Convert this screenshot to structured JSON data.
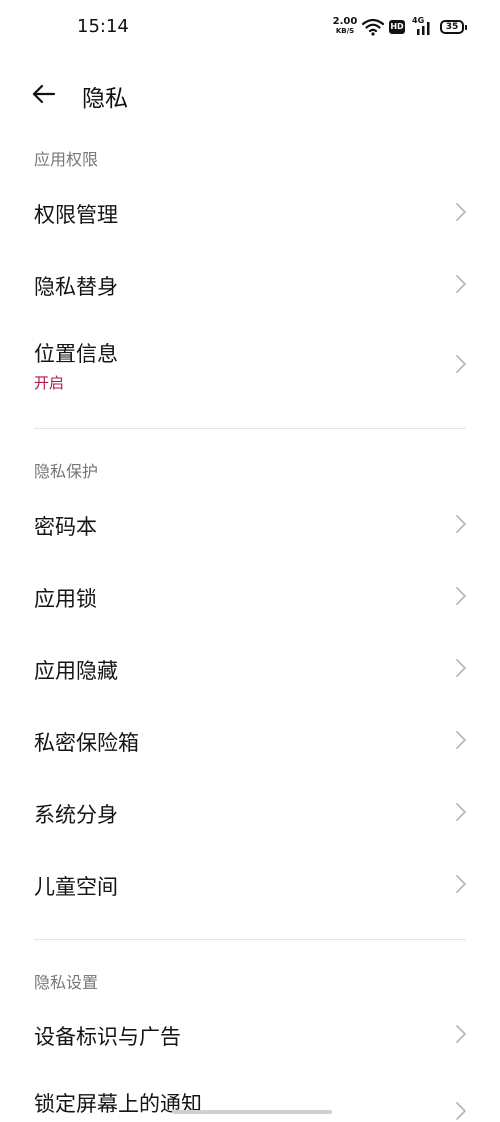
{
  "status_bar": {
    "time": "15:14",
    "net_speed_value": "2.00",
    "net_speed_unit": "KB/S",
    "hd_badge": "HD",
    "network_type": "4G",
    "battery": "35"
  },
  "header": {
    "title": "隐私"
  },
  "sections": [
    {
      "header": "应用权限",
      "items": [
        {
          "label": "权限管理"
        },
        {
          "label": "隐私替身"
        },
        {
          "label": "位置信息",
          "sub": "开启"
        }
      ]
    },
    {
      "header": "隐私保护",
      "items": [
        {
          "label": "密码本"
        },
        {
          "label": "应用锁"
        },
        {
          "label": "应用隐藏"
        },
        {
          "label": "私密保险箱"
        },
        {
          "label": "系统分身"
        },
        {
          "label": "儿童空间"
        }
      ]
    },
    {
      "header": "隐私设置",
      "items": [
        {
          "label": "设备标识与广告"
        },
        {
          "label": "锁定屏幕上的通知"
        }
      ]
    }
  ],
  "colors": {
    "accent": "#b0194a",
    "divider": "#e6e6e6",
    "section_header": "#777777"
  },
  "icons": {
    "back": "arrow-left-icon",
    "chevron": "chevron-right-icon",
    "wifi": "wifi-icon",
    "signal": "signal-icon",
    "battery": "battery-icon"
  }
}
